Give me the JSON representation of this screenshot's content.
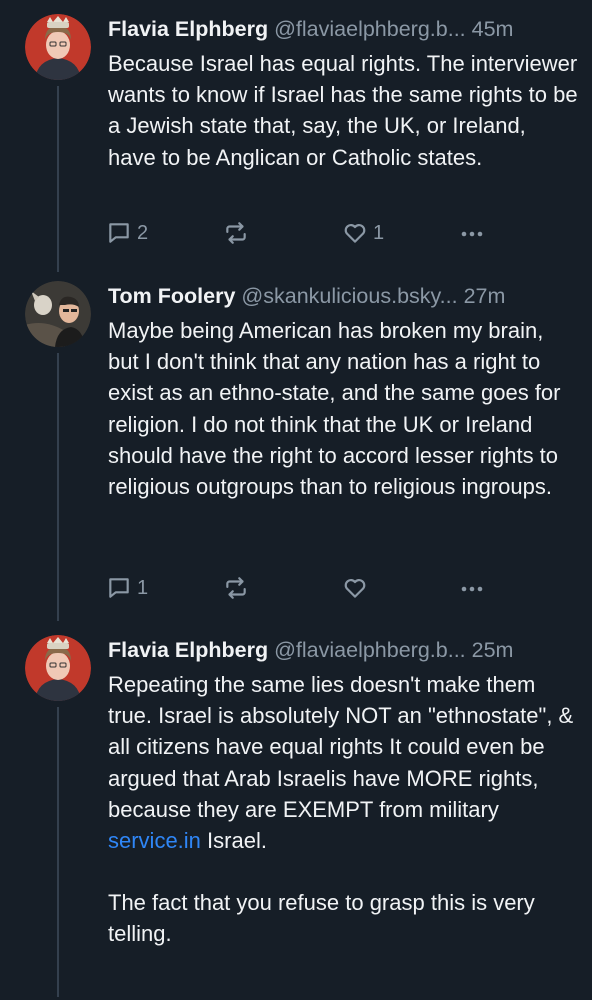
{
  "posts": [
    {
      "author_name": "Flavia Elphberg",
      "author_handle": "@flaviaelphberg.b...",
      "time": "45m",
      "avatar": "crowned-woman-avatar",
      "body": [
        "Because Israel has equal rights. The interviewer wants to know if Israel has the same rights to be a Jewish state that, say, the UK, or Ireland, have to be Anglican or Catholic states."
      ],
      "reply_count": "2",
      "repost_count": "",
      "like_count": "1"
    },
    {
      "author_name": "Tom Foolery",
      "author_handle": "@skankulicious.bsky...",
      "time": "27m",
      "avatar": "two-figures-avatar",
      "body": [
        "Maybe being American has broken my brain, but I don't think that any nation has a right to exist as an ethno-state, and the same goes for religion. I do not think that the UK or Ireland should have the right to accord lesser rights to religious outgroups than to religious ingroups."
      ],
      "reply_count": "1",
      "repost_count": "",
      "like_count": ""
    },
    {
      "author_name": "Flavia Elphberg",
      "author_handle": "@flaviaelphberg.b...",
      "time": "25m",
      "avatar": "crowned-woman-avatar",
      "body_lead": "Repeating the same lies doesn't make them true. Israel is absolutely NOT an \"ethnostate\", & all citizens have equal rights  It could even be argued that Arab Israelis have MORE rights, because they are EXEMPT from military ",
      "body_link": "service.in",
      "body_tail": " Israel.",
      "body_p2": "The fact that you refuse to grasp this is very telling."
    }
  ],
  "icons": {
    "reply": "speech-bubble-icon",
    "repost": "repost-arrows-icon",
    "like": "heart-icon",
    "more": "ellipsis-icon"
  },
  "colors": {
    "background": "#161e27",
    "text": "#f1f3f5",
    "muted": "#8b98a5",
    "link": "#2f86f6",
    "thread_line": "#34404e"
  }
}
